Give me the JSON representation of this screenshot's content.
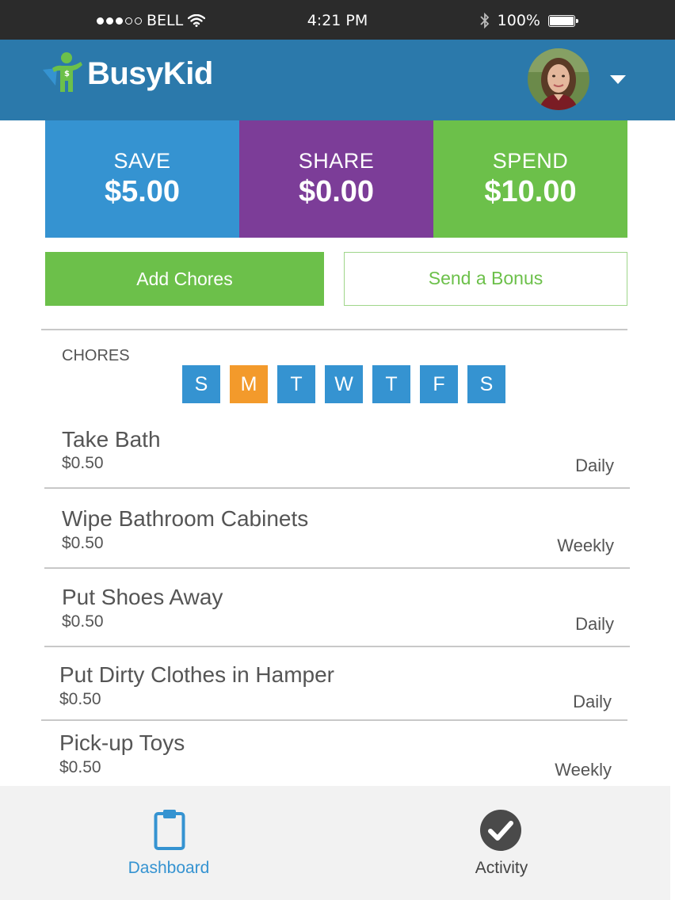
{
  "status_bar": {
    "carrier": "BELL",
    "time": "4:21 PM",
    "battery": "100%"
  },
  "header": {
    "app_name": "BusyKid",
    "logo_icon": "busykid-figure-icon",
    "avatar_icon": "user-avatar",
    "menu_icon": "caret-down-icon"
  },
  "balances": [
    {
      "label": "SAVE",
      "amount": "$5.00",
      "color": "#3593d1"
    },
    {
      "label": "SHARE",
      "amount": "$0.00",
      "color": "#7c3d98"
    },
    {
      "label": "SPEND",
      "amount": "$10.00",
      "color": "#6cc04a"
    }
  ],
  "actions": {
    "add_chores": "Add Chores",
    "send_bonus": "Send a Bonus"
  },
  "chores": {
    "heading": "CHORES",
    "days": [
      "S",
      "M",
      "T",
      "W",
      "T",
      "F",
      "S"
    ],
    "active_day_index": 1,
    "items": [
      {
        "title": "Take Bath",
        "price": "$0.50",
        "frequency": "Daily"
      },
      {
        "title": "Wipe Bathroom Cabinets",
        "price": "$0.50",
        "frequency": "Weekly"
      },
      {
        "title": "Put Shoes Away",
        "price": "$0.50",
        "frequency": "Daily"
      },
      {
        "title": "Put Dirty Clothes in Hamper",
        "price": "$0.50",
        "frequency": "Daily"
      },
      {
        "title": "Pick-up Toys",
        "price": "$0.50",
        "frequency": "Weekly"
      }
    ]
  },
  "tab_bar": {
    "tabs": [
      {
        "label": "Dashboard",
        "icon": "clipboard-icon",
        "active": true
      },
      {
        "label": "Activity",
        "icon": "checkmark-circle-icon",
        "active": false
      }
    ]
  },
  "colors": {
    "header": "#2b79ab",
    "accent_blue": "#3593d1",
    "accent_orange": "#f39a2b",
    "accent_green": "#6cc04a",
    "accent_purple": "#7c3d98"
  }
}
